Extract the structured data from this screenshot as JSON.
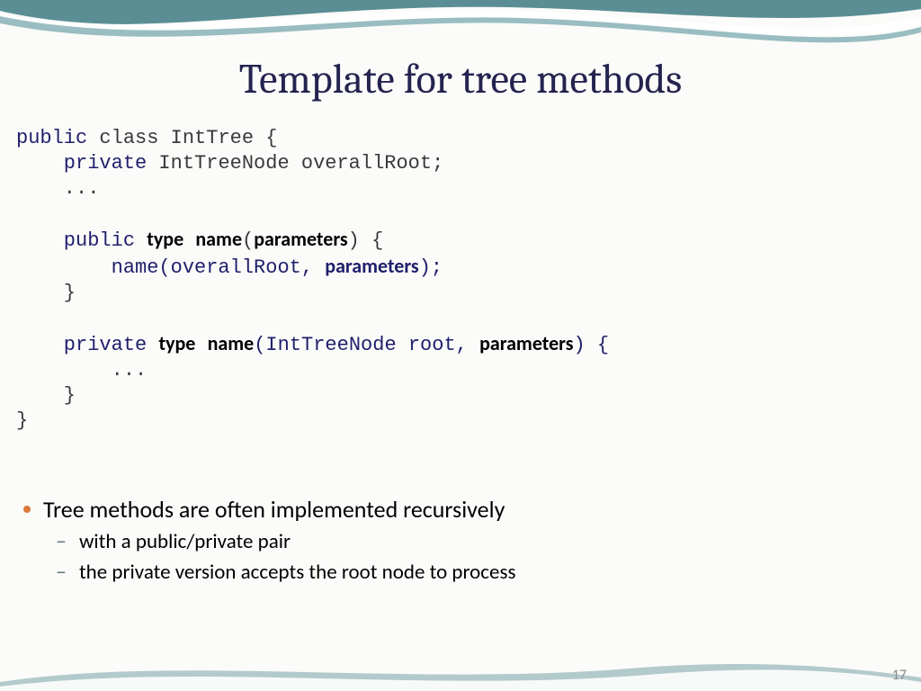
{
  "title": "Template for tree methods",
  "code": {
    "l1a": "public",
    "l1b": " class IntTree {",
    "l2a": "    private",
    "l2b": " IntTreeNode overallRoot;",
    "l3": "    ...",
    "l5a": "    public ",
    "l5b": "type",
    "l5c": " ",
    "l5d": "name",
    "l5e": "(",
    "l5f": "parameters",
    "l5g": ") {",
    "l6a": "        name(overallRoot, ",
    "l6b": "parameters",
    "l6c": ");",
    "l7": "    }",
    "l9a": "    private ",
    "l9b": "type",
    "l9c": " ",
    "l9d": "name",
    "l9e": "(IntTreeNode root, ",
    "l9f": "parameters",
    "l9g": ") {",
    "l10": "        ...",
    "l11": "    }",
    "l12": "}"
  },
  "bullets": {
    "main": "Tree methods are often implemented recursively",
    "sub1": "with a public/private pair",
    "sub2": "the private version accepts the root node to process"
  },
  "pageNumber": "17"
}
